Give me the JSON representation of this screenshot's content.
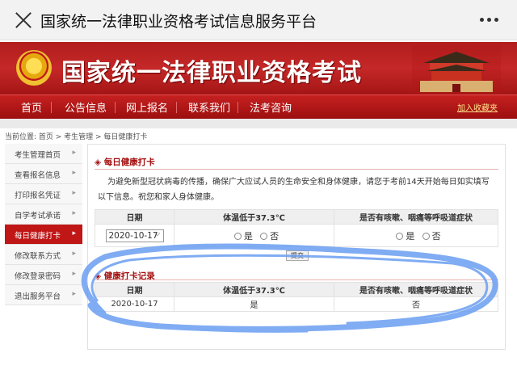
{
  "app": {
    "title": "国家统一法律职业资格考试信息服务平台"
  },
  "banner": {
    "title": "国家统一法律职业资格考试"
  },
  "nav": {
    "items": [
      "首页",
      "公告信息",
      "网上报名",
      "联系我们",
      "法考咨询"
    ],
    "favorite": "加入收藏夹"
  },
  "breadcrumb": "当前位置: 首页 > 考生管理 > 每日健康打卡",
  "sidebar": {
    "items": [
      "考生管理首页",
      "查看报名信息",
      "打印报名凭证",
      "自学考试承诺",
      "每日健康打卡",
      "修改联系方式",
      "修改登录密码",
      "退出服务平台"
    ],
    "active_index": 4
  },
  "checkin": {
    "heading": "每日健康打卡",
    "notice": "为避免新型冠状病毒的传播，确保广大应试人员的生命安全和身体健康，请您于考前14天开始每日如实填写以下信息。祝您和家人身体健康。",
    "headers": [
      "日期",
      "体温低于37.3℃",
      "是否有咳嗽、咽痛等呼吸道症状"
    ],
    "date_value": "2020-10-17",
    "yes": "是",
    "no": "否",
    "submit": "提交"
  },
  "records": {
    "heading": "健康打卡记录",
    "headers": [
      "日期",
      "体温低于37.3℃",
      "是否有咳嗽、咽痛等呼吸道症状"
    ],
    "rows": [
      {
        "date": "2020-10-17",
        "temp_ok": "是",
        "symptoms": "否"
      }
    ]
  },
  "colors": {
    "brand_red": "#c01616",
    "annotation_blue": "#6a9ef2"
  }
}
